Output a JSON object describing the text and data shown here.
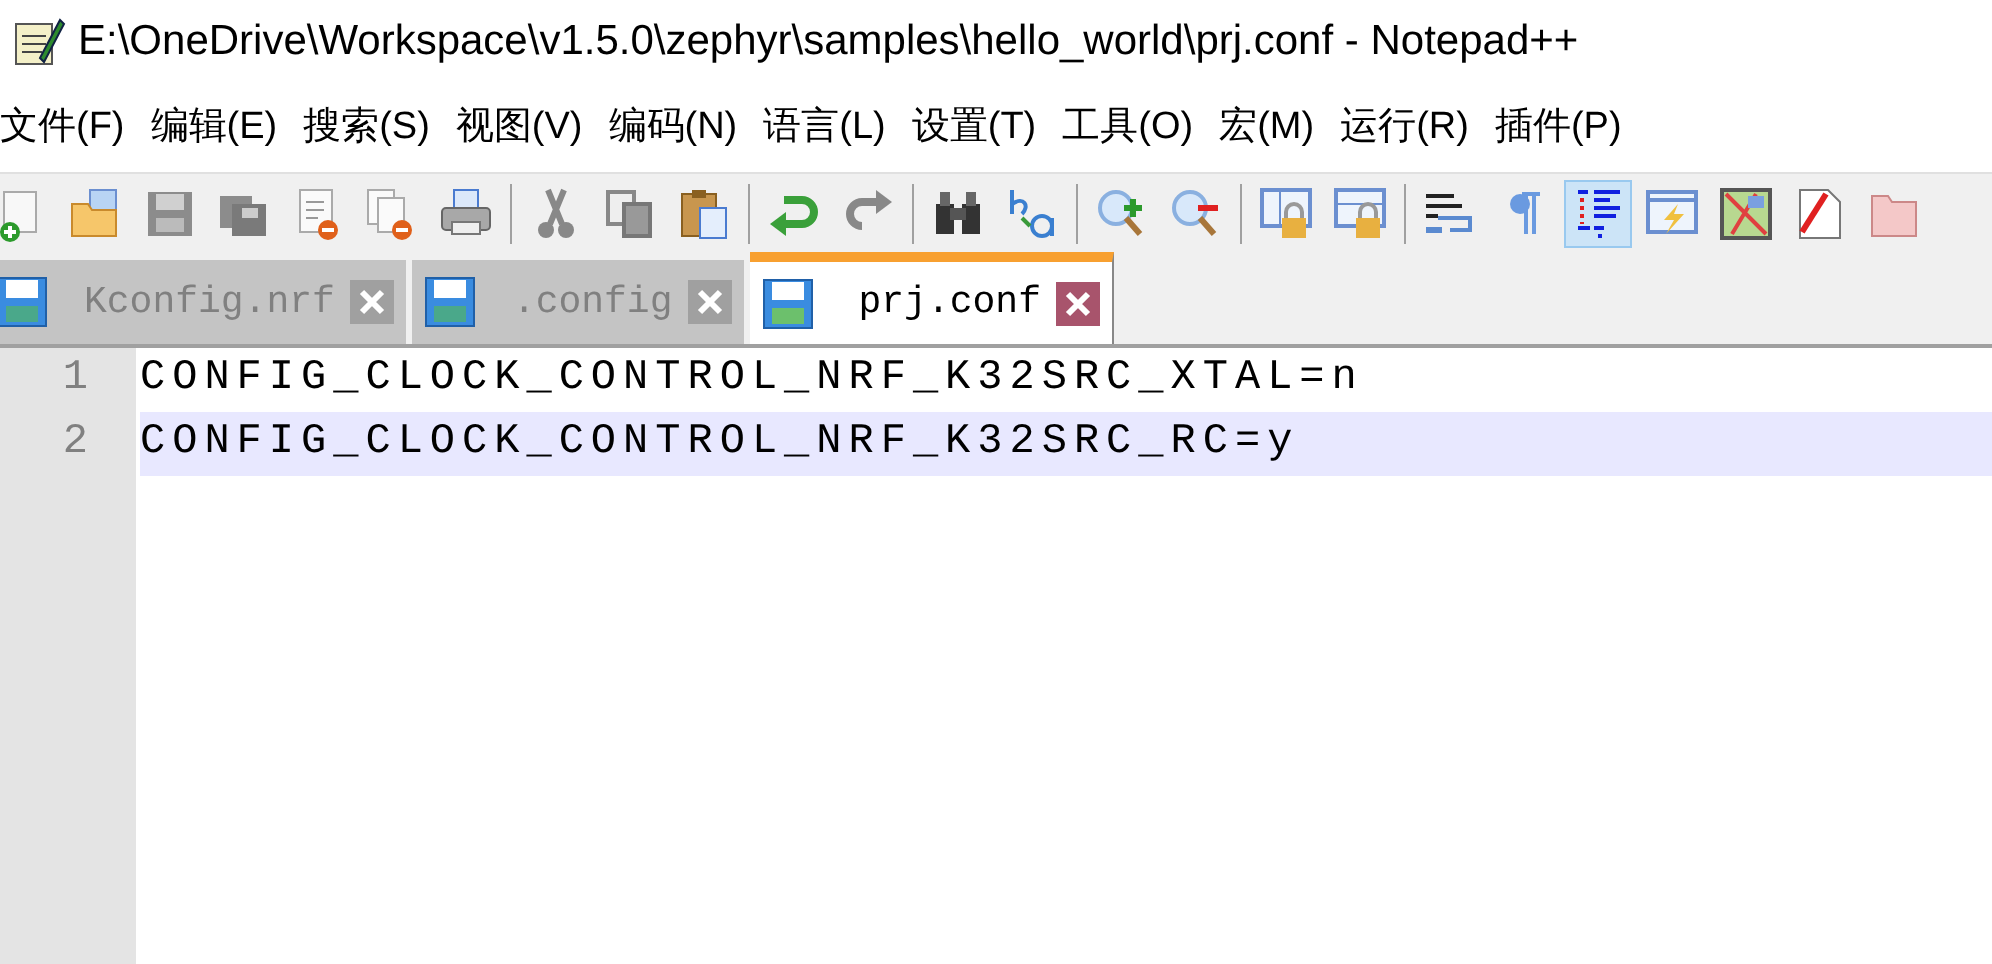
{
  "window": {
    "title": "E:\\OneDrive\\Workspace\\v1.5.0\\zephyr\\samples\\hello_world\\prj.conf - Notepad++"
  },
  "menu": [
    "文件(F)",
    "编辑(E)",
    "搜索(S)",
    "视图(V)",
    "编码(N)",
    "语言(L)",
    "设置(T)",
    "工具(O)",
    "宏(M)",
    "运行(R)",
    "插件(P)"
  ],
  "toolbar": [
    {
      "kind": "new",
      "pressed": false
    },
    {
      "kind": "open",
      "pressed": false
    },
    {
      "kind": "save",
      "pressed": false
    },
    {
      "kind": "save-all",
      "pressed": false
    },
    {
      "kind": "close",
      "pressed": false
    },
    {
      "kind": "close-all",
      "pressed": false
    },
    {
      "kind": "print",
      "pressed": false
    },
    {
      "kind": "separator"
    },
    {
      "kind": "cut",
      "pressed": false
    },
    {
      "kind": "copy",
      "pressed": false
    },
    {
      "kind": "paste",
      "pressed": false
    },
    {
      "kind": "separator"
    },
    {
      "kind": "undo",
      "pressed": false
    },
    {
      "kind": "redo",
      "pressed": false
    },
    {
      "kind": "separator"
    },
    {
      "kind": "find",
      "pressed": false
    },
    {
      "kind": "replace",
      "pressed": false
    },
    {
      "kind": "separator"
    },
    {
      "kind": "zoom-in",
      "pressed": false
    },
    {
      "kind": "zoom-out",
      "pressed": false
    },
    {
      "kind": "separator"
    },
    {
      "kind": "sync-v",
      "pressed": false
    },
    {
      "kind": "sync-h",
      "pressed": false
    },
    {
      "kind": "separator"
    },
    {
      "kind": "wrap",
      "pressed": false
    },
    {
      "kind": "pilcrow",
      "pressed": false
    },
    {
      "kind": "indent-guide",
      "pressed": true
    },
    {
      "kind": "lang",
      "pressed": false
    },
    {
      "kind": "map",
      "pressed": false
    },
    {
      "kind": "func",
      "pressed": false
    },
    {
      "kind": "folder",
      "pressed": false
    }
  ],
  "tabs": [
    {
      "label": "Kconfig.nrf",
      "selected": false
    },
    {
      "label": ".config",
      "selected": false
    },
    {
      "label": "prj.conf",
      "selected": true
    }
  ],
  "editor": {
    "lines": [
      {
        "number": "1",
        "text": "CONFIG_CLOCK_CONTROL_NRF_K32SRC_XTAL=n",
        "current": false
      },
      {
        "number": "2",
        "text": "CONFIG_CLOCK_CONTROL_NRF_K32SRC_RC=y",
        "current": true
      }
    ]
  }
}
